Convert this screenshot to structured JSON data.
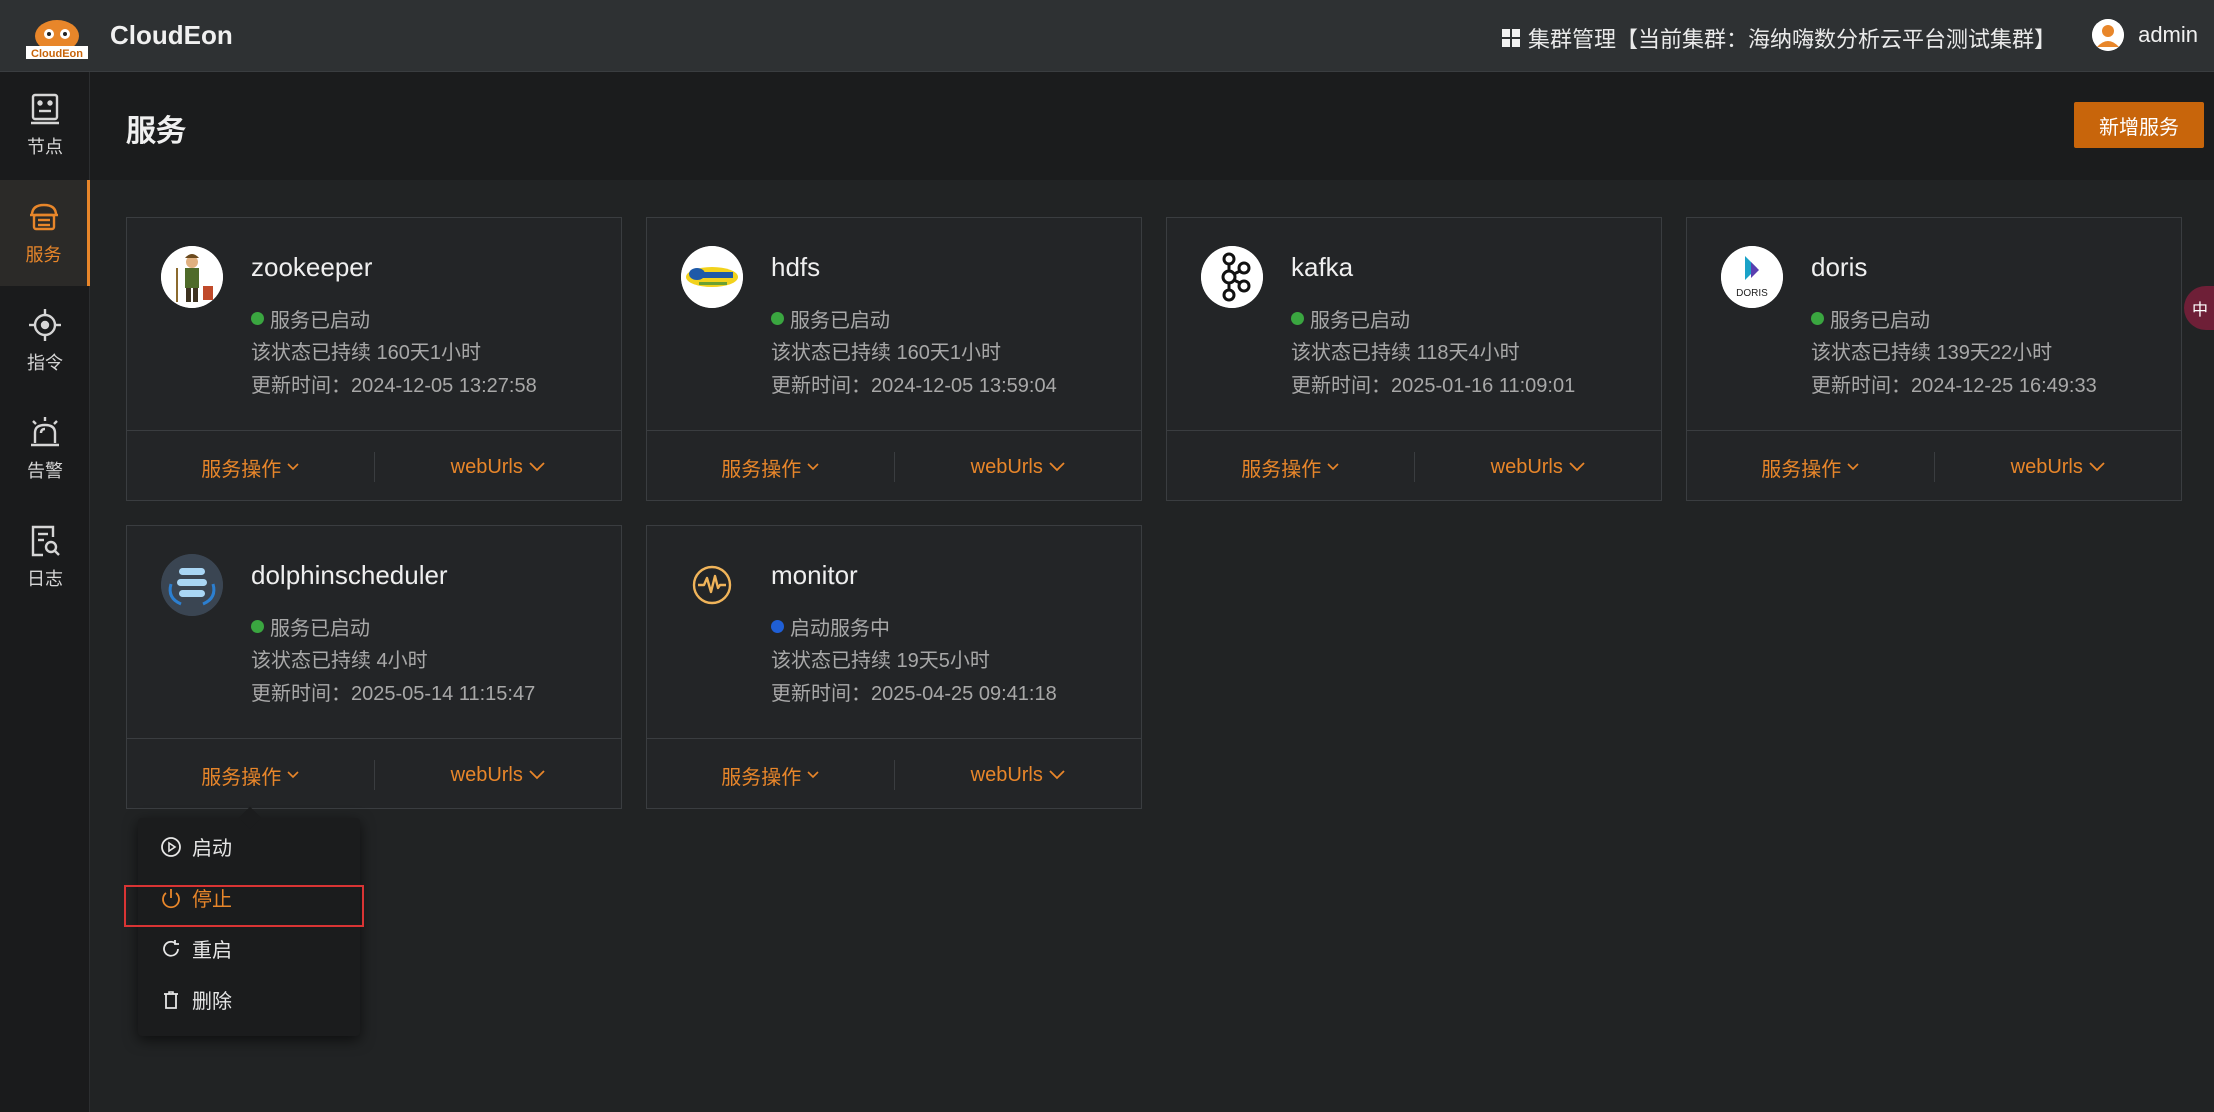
{
  "app": {
    "brand": "CloudEon",
    "logo_text": "CloudEon"
  },
  "topbar": {
    "cluster_label": "集群管理【当前集群：海纳嗨数分析云平台测试集群】",
    "user_name": "admin"
  },
  "sidebar": {
    "items": [
      {
        "label": "节点",
        "icon": "node-icon",
        "active": false
      },
      {
        "label": "服务",
        "icon": "service-icon",
        "active": true
      },
      {
        "label": "指令",
        "icon": "command-icon",
        "active": false
      },
      {
        "label": "告警",
        "icon": "alarm-icon",
        "active": false
      },
      {
        "label": "日志",
        "icon": "log-icon",
        "active": false
      }
    ]
  },
  "page": {
    "title": "服务",
    "add_button": "新增服务"
  },
  "services": [
    {
      "name": "zookeeper",
      "status": "服务已启动",
      "status_color": "#3aa640",
      "duration": "该状态已持续 160天1小时",
      "updated": "更新时间：2024-12-05 13:27:58",
      "icon": "zookeeper-icon"
    },
    {
      "name": "hdfs",
      "status": "服务已启动",
      "status_color": "#3aa640",
      "duration": "该状态已持续 160天1小时",
      "updated": "更新时间：2024-12-05 13:59:04",
      "icon": "hadoop-icon"
    },
    {
      "name": "kafka",
      "status": "服务已启动",
      "status_color": "#3aa640",
      "duration": "该状态已持续 118天4小时",
      "updated": "更新时间：2025-01-16 11:09:01",
      "icon": "kafka-icon"
    },
    {
      "name": "doris",
      "status": "服务已启动",
      "status_color": "#3aa640",
      "duration": "该状态已持续 139天22小时",
      "updated": "更新时间：2024-12-25 16:49:33",
      "icon": "doris-icon",
      "icon_text": "DORIS"
    },
    {
      "name": "dolphinscheduler",
      "status": "服务已启动",
      "status_color": "#3aa640",
      "duration": "该状态已持续 4小时",
      "updated": "更新时间：2025-05-14 11:15:47",
      "icon": "dolphinscheduler-icon"
    },
    {
      "name": "monitor",
      "status": "启动服务中",
      "status_color": "#1f5fd6",
      "duration": "该状态已持续 19天5小时",
      "updated": "更新时间：2025-04-25 09:41:18",
      "icon": "monitor-icon"
    }
  ],
  "card_actions": {
    "ops": "服务操作",
    "urls": "webUrls"
  },
  "dropdown": {
    "items": [
      {
        "label": "启动",
        "icon": "play-circle-icon"
      },
      {
        "label": "停止",
        "icon": "power-icon"
      },
      {
        "label": "重启",
        "icon": "refresh-icon"
      },
      {
        "label": "删除",
        "icon": "trash-icon"
      }
    ]
  },
  "lang_badge": "中",
  "colors": {
    "accent": "#e8862a",
    "running": "#3aa640",
    "starting": "#1f5fd6",
    "highlight": "#d93434"
  }
}
